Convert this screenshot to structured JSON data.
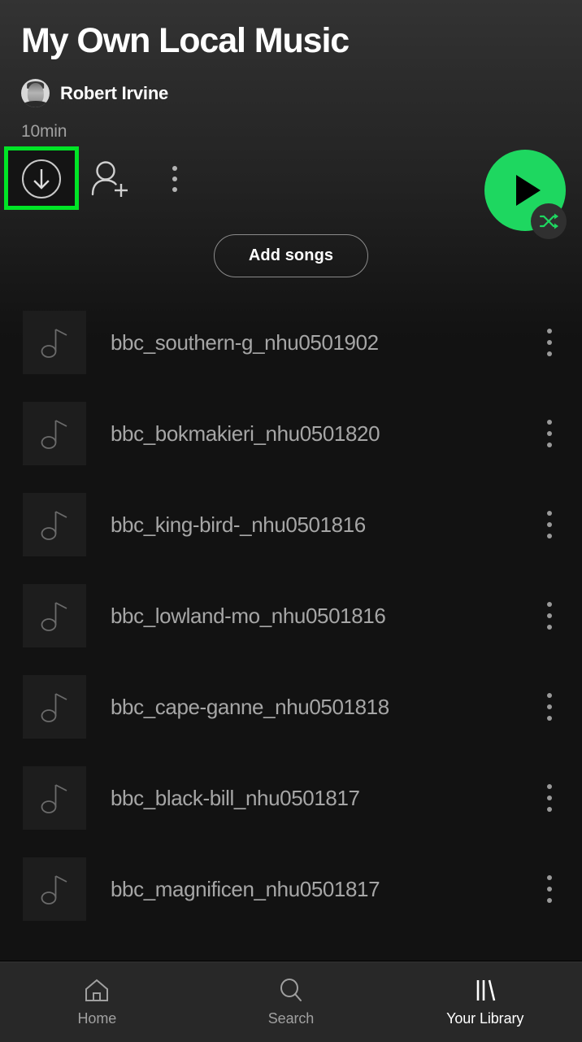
{
  "header": {
    "playlist_title": "My Own Local Music",
    "owner_name": "Robert Irvine",
    "duration": "10min",
    "avatar_icon": "user-avatar"
  },
  "actions": {
    "download_icon": "download-circle-icon",
    "add_user_icon": "add-user-icon",
    "more_icon": "more-vertical-icon",
    "play_icon": "play-icon",
    "shuffle_icon": "shuffle-icon",
    "highlight_color": "#00e526",
    "play_button_color": "#1ed760"
  },
  "add_songs": {
    "label": "Add songs"
  },
  "tracks": [
    {
      "title": "bbc_southern-g_nhu0501902",
      "thumb_icon": "music-note-icon",
      "more_icon": "more-vertical-icon"
    },
    {
      "title": "bbc_bokmakieri_nhu0501820",
      "thumb_icon": "music-note-icon",
      "more_icon": "more-vertical-icon"
    },
    {
      "title": "bbc_king-bird-_nhu0501816",
      "thumb_icon": "music-note-icon",
      "more_icon": "more-vertical-icon"
    },
    {
      "title": "bbc_lowland-mo_nhu0501816",
      "thumb_icon": "music-note-icon",
      "more_icon": "more-vertical-icon"
    },
    {
      "title": "bbc_cape-ganne_nhu0501818",
      "thumb_icon": "music-note-icon",
      "more_icon": "more-vertical-icon"
    },
    {
      "title": "bbc_black-bill_nhu0501817",
      "thumb_icon": "music-note-icon",
      "more_icon": "more-vertical-icon"
    },
    {
      "title": "bbc_magnificen_nhu0501817",
      "thumb_icon": "music-note-icon",
      "more_icon": "more-vertical-icon"
    }
  ],
  "bottom_nav": {
    "items": [
      {
        "label": "Home",
        "icon": "home-icon",
        "active": false
      },
      {
        "label": "Search",
        "icon": "search-icon",
        "active": false
      },
      {
        "label": "Your Library",
        "icon": "library-icon",
        "active": true
      }
    ]
  }
}
